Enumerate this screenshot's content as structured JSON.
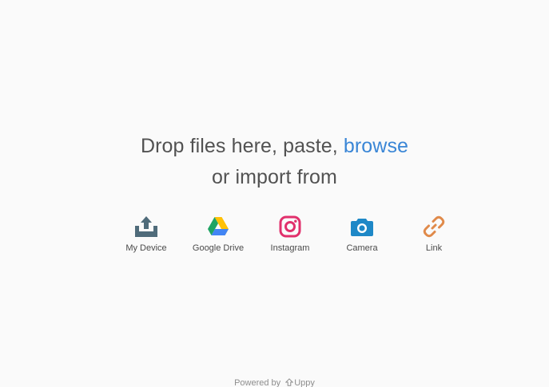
{
  "dropzone": {
    "line1_prefix": "Drop files here, paste, ",
    "browse_label": "browse",
    "line2": "or import from"
  },
  "sources": [
    {
      "label": "My Device",
      "icon": "upload-tray-icon",
      "color": "#4f6b7a"
    },
    {
      "label": "Google Drive",
      "icon": "google-drive-icon",
      "color": "#1fa463"
    },
    {
      "label": "Instagram",
      "icon": "instagram-icon",
      "color": "#e1306c"
    },
    {
      "label": "Camera",
      "icon": "camera-icon",
      "color": "#1e88c7"
    },
    {
      "label": "Link",
      "icon": "link-icon",
      "color": "#e08a4a"
    }
  ],
  "footer": {
    "powered_label": "Powered by",
    "brand": "Uppy"
  }
}
